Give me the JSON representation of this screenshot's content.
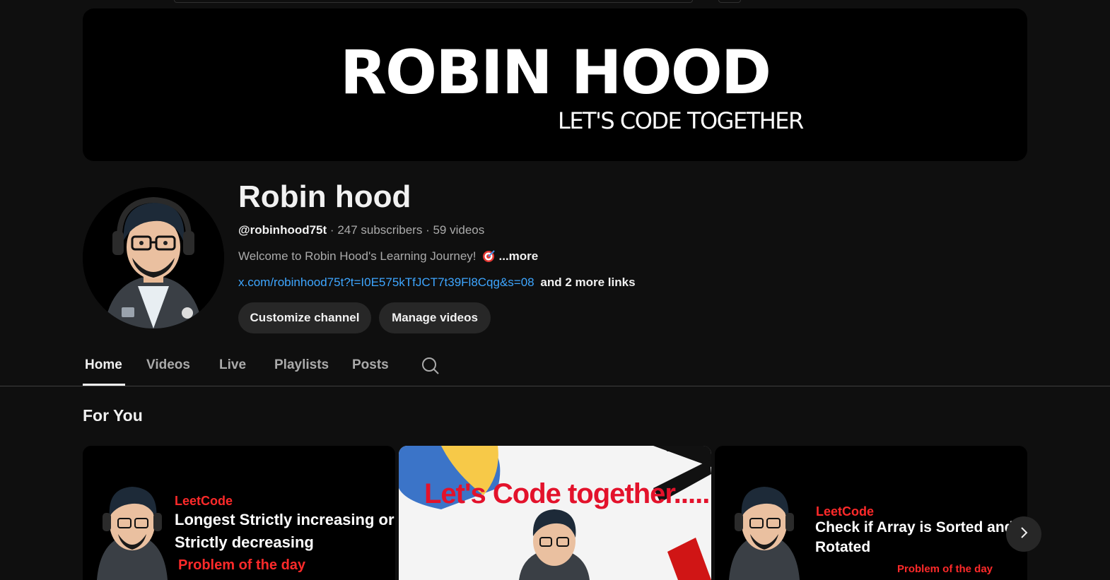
{
  "banner": {
    "title": "ROBIN HOOD",
    "subtitle": "LET'S CODE TOGETHER"
  },
  "channel": {
    "name": "Robin hood",
    "handle": "@robinhood75t",
    "subscribers": "247 subscribers",
    "videos": "59 videos",
    "description": "Welcome to Robin Hood's Learning Journey!",
    "more_label": "...more",
    "link": "x.com/robinhood75t?t=I0E575kTfJCT7t39Fl8Cqg&s=08",
    "more_links": "and 2 more links"
  },
  "buttons": {
    "customize": "Customize channel",
    "manage": "Manage videos"
  },
  "tabs": [
    {
      "label": "Home",
      "active": true
    },
    {
      "label": "Videos"
    },
    {
      "label": "Live"
    },
    {
      "label": "Playlists"
    },
    {
      "label": "Posts"
    }
  ],
  "section": {
    "title": "For You"
  },
  "videos": [
    {
      "tag": "LeetCode",
      "line1": "Longest Strictly increasing or",
      "line2": "Strictly decreasing",
      "line3": "Problem of the day"
    },
    {
      "headline": "Let's Code together......"
    },
    {
      "tag": "LeetCode",
      "line1": "Check if Array is Sorted and",
      "line2": "Rotated",
      "line3": "Problem of the day"
    }
  ],
  "icons": {
    "search": "search-icon",
    "next": "chevron-right-icon",
    "emoji": "direct-hit-icon"
  },
  "colors": {
    "background": "#0f0f0f",
    "link": "#3ea6ff",
    "button_bg": "#272727",
    "leetcode_red": "#ff2a2a"
  }
}
